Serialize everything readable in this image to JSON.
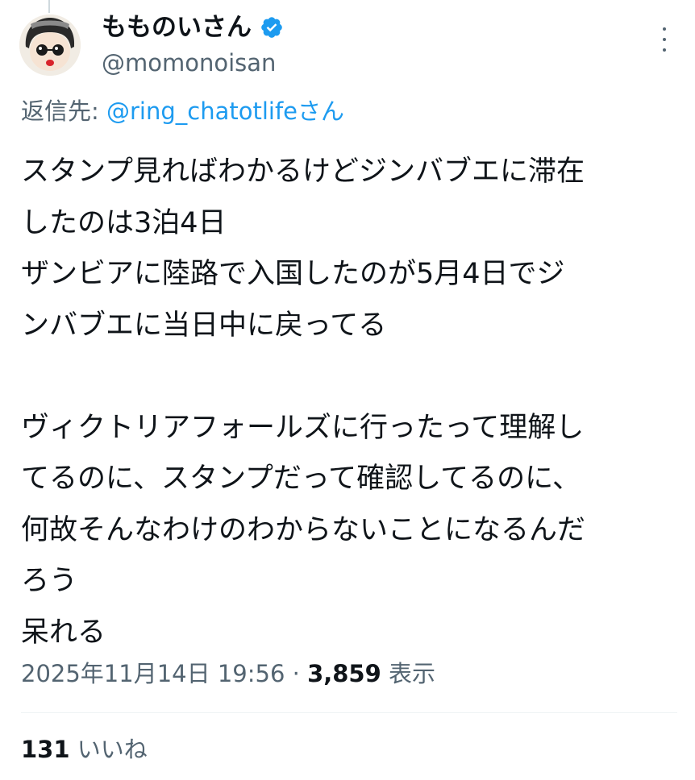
{
  "author": {
    "display_name": "もものいさん",
    "handle": "@momonoisan",
    "verified": true,
    "avatar_icon": "cartoon-face-avatar"
  },
  "reply": {
    "prefix": "返信先: ",
    "mention": "@ring_chatotlifeさん"
  },
  "tweet": {
    "lines": [
      "スタンプ見ればわかるけどジンバブエに滞在",
      "したのは3泊4日",
      "ザンビアに陸路で入国したのが5月4日でジ",
      "ンバブエに当日中に戻ってる",
      "",
      "ヴィクトリアフォールズに行ったって理解し",
      "てるのに、スタンプだって確認してるのに、",
      "何故そんなわけのわからないことになるんだ",
      "ろう",
      "呆れる"
    ]
  },
  "meta": {
    "timestamp": "2025年11月14日 19:56",
    "separator": " · ",
    "views_count": "3,859",
    "views_label": " 表示"
  },
  "engagement": {
    "likes_count": "131",
    "likes_label": " いいね"
  },
  "colors": {
    "text_primary": "#0f1419",
    "text_secondary": "#536471",
    "accent": "#1d9bf0",
    "divider": "#eff3f4"
  }
}
